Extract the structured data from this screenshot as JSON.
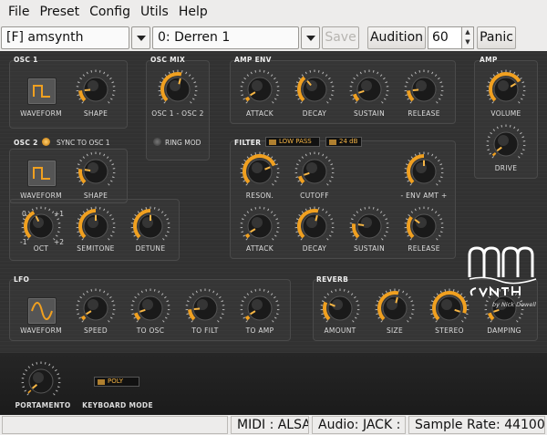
{
  "menu": [
    "File",
    "Preset",
    "Config",
    "Utils",
    "Help"
  ],
  "toolbar": {
    "bank": "[F] amsynth factory",
    "preset": "0: Derren 1",
    "save": "Save",
    "audition": "Audition",
    "velocity": "60",
    "panic": "Panic"
  },
  "sections": {
    "osc1": "OSC 1",
    "osc2": "OSC 2",
    "sync": "SYNC TO OSC 1",
    "oscmix": "OSC MIX",
    "ampenv": "AMP ENV",
    "amp": "AMP",
    "filter": "FILTER",
    "lfo": "LFO",
    "reverb": "REVERB"
  },
  "labels": {
    "waveform": "WAVEFORM",
    "shape": "SHAPE",
    "mix": "OSC 1 - OSC 2",
    "ringmod": "RING MOD",
    "attack": "ATTACK",
    "decay": "DECAY",
    "sustain": "SUSTAIN",
    "release": "RELEASE",
    "volume": "VOLUME",
    "drive": "DRIVE",
    "reson": "RESON.",
    "cutoff": "CUTOFF",
    "envamt": "- ENV AMT +",
    "oct": "OCT",
    "semitone": "SEMITONE",
    "detune": "DETUNE",
    "oct0": "0",
    "octp1": "+1",
    "octm1": "-1",
    "octp2": "+2",
    "speed": "SPEED",
    "toosc": "TO OSC",
    "tofilt": "TO FILT",
    "toamp": "TO AMP",
    "amount": "AMOUNT",
    "size": "SIZE",
    "stereo": "STEREO",
    "damping": "DAMPING",
    "portamento": "PORTAMENTO",
    "kbmode": "KEYBOARD MODE"
  },
  "filter": {
    "type": "LOW PASS",
    "slope": "24 dB"
  },
  "keyboard_mode": "POLY",
  "logo": {
    "brand": "amSynth",
    "byline": "by Nick Dowell"
  },
  "status": {
    "blank": "",
    "midi": "MIDI : ALSA",
    "audio": "Audio: JACK :",
    "rate": "Sample Rate: 44100"
  },
  "colors": {
    "accent": "#f0a020",
    "knob": "#1a1a1a"
  },
  "knob_values": {
    "osc1_shape": 0.15,
    "osc_mix": 0.55,
    "osc2_shape": 0.2,
    "oct": 0.4,
    "semitone": 0.5,
    "detune": 0.5,
    "amp_attack": 0.05,
    "amp_decay": 0.35,
    "amp_sustain": 0.1,
    "amp_release": 0.15,
    "volume": 0.72,
    "drive": 0.03,
    "reson": 0.75,
    "cutoff": 0.1,
    "envamt": 0.5,
    "f_attack": 0.05,
    "f_decay": 0.55,
    "f_sustain": 0.2,
    "f_release": 0.3,
    "lfo_speed": 0.05,
    "to_osc": 0.1,
    "to_filt": 0.15,
    "to_amp": 0.05,
    "rv_amount": 0.25,
    "rv_size": 0.55,
    "rv_stereo": 0.9,
    "rv_damping": 0.1,
    "portamento": 0.02
  }
}
